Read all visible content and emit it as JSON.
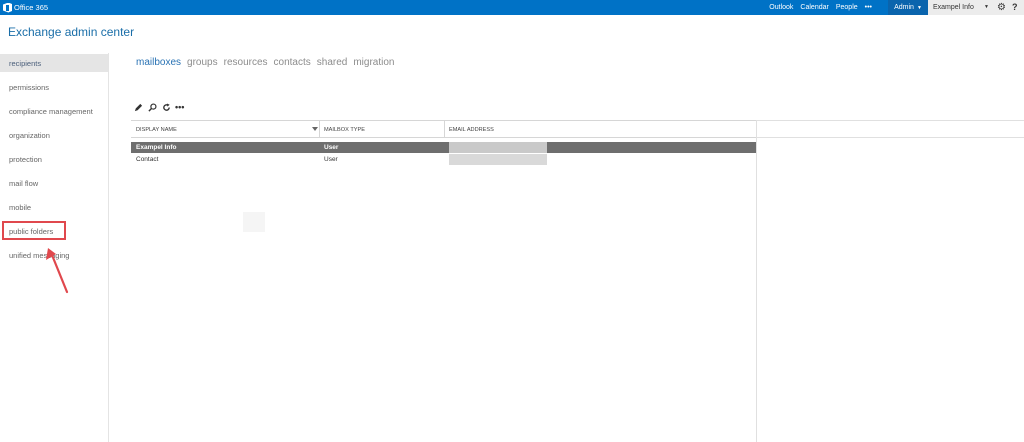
{
  "topbar": {
    "brand": "Office 365",
    "nav": [
      "Outlook",
      "Calendar",
      "People",
      "•••"
    ],
    "admin_label": "Admin",
    "user_name": "Exampel Info",
    "gear_icon": "gear-icon",
    "help_icon": "help-icon",
    "help_text": "?",
    "bar_color": "#0072c6"
  },
  "app": {
    "title": "Exchange admin center"
  },
  "sidebar": {
    "items": [
      {
        "label": "recipients",
        "active": true
      },
      {
        "label": "permissions"
      },
      {
        "label": "compliance management"
      },
      {
        "label": "organization"
      },
      {
        "label": "protection"
      },
      {
        "label": "mail flow"
      },
      {
        "label": "mobile"
      },
      {
        "label": "public folders",
        "highlighted": true
      },
      {
        "label": "unified messaging"
      }
    ]
  },
  "tabs": [
    "mailboxes",
    "groups",
    "resources",
    "contacts",
    "shared",
    "migration"
  ],
  "toolbar": {
    "icons": [
      "edit-icon",
      "search-icon",
      "refresh-icon"
    ],
    "more": "•••"
  },
  "table": {
    "columns": [
      "DISPLAY NAME",
      "MAILBOX TYPE",
      "EMAIL ADDRESS"
    ],
    "rows": [
      {
        "display_name": "Exampel Info",
        "mailbox_type": "User",
        "selected": true
      },
      {
        "display_name": "Contact",
        "mailbox_type": "User"
      }
    ]
  },
  "colors": {
    "accent": "#2a73b4",
    "highlight": "#e0484d",
    "selected_row": "#6e6e6e"
  }
}
